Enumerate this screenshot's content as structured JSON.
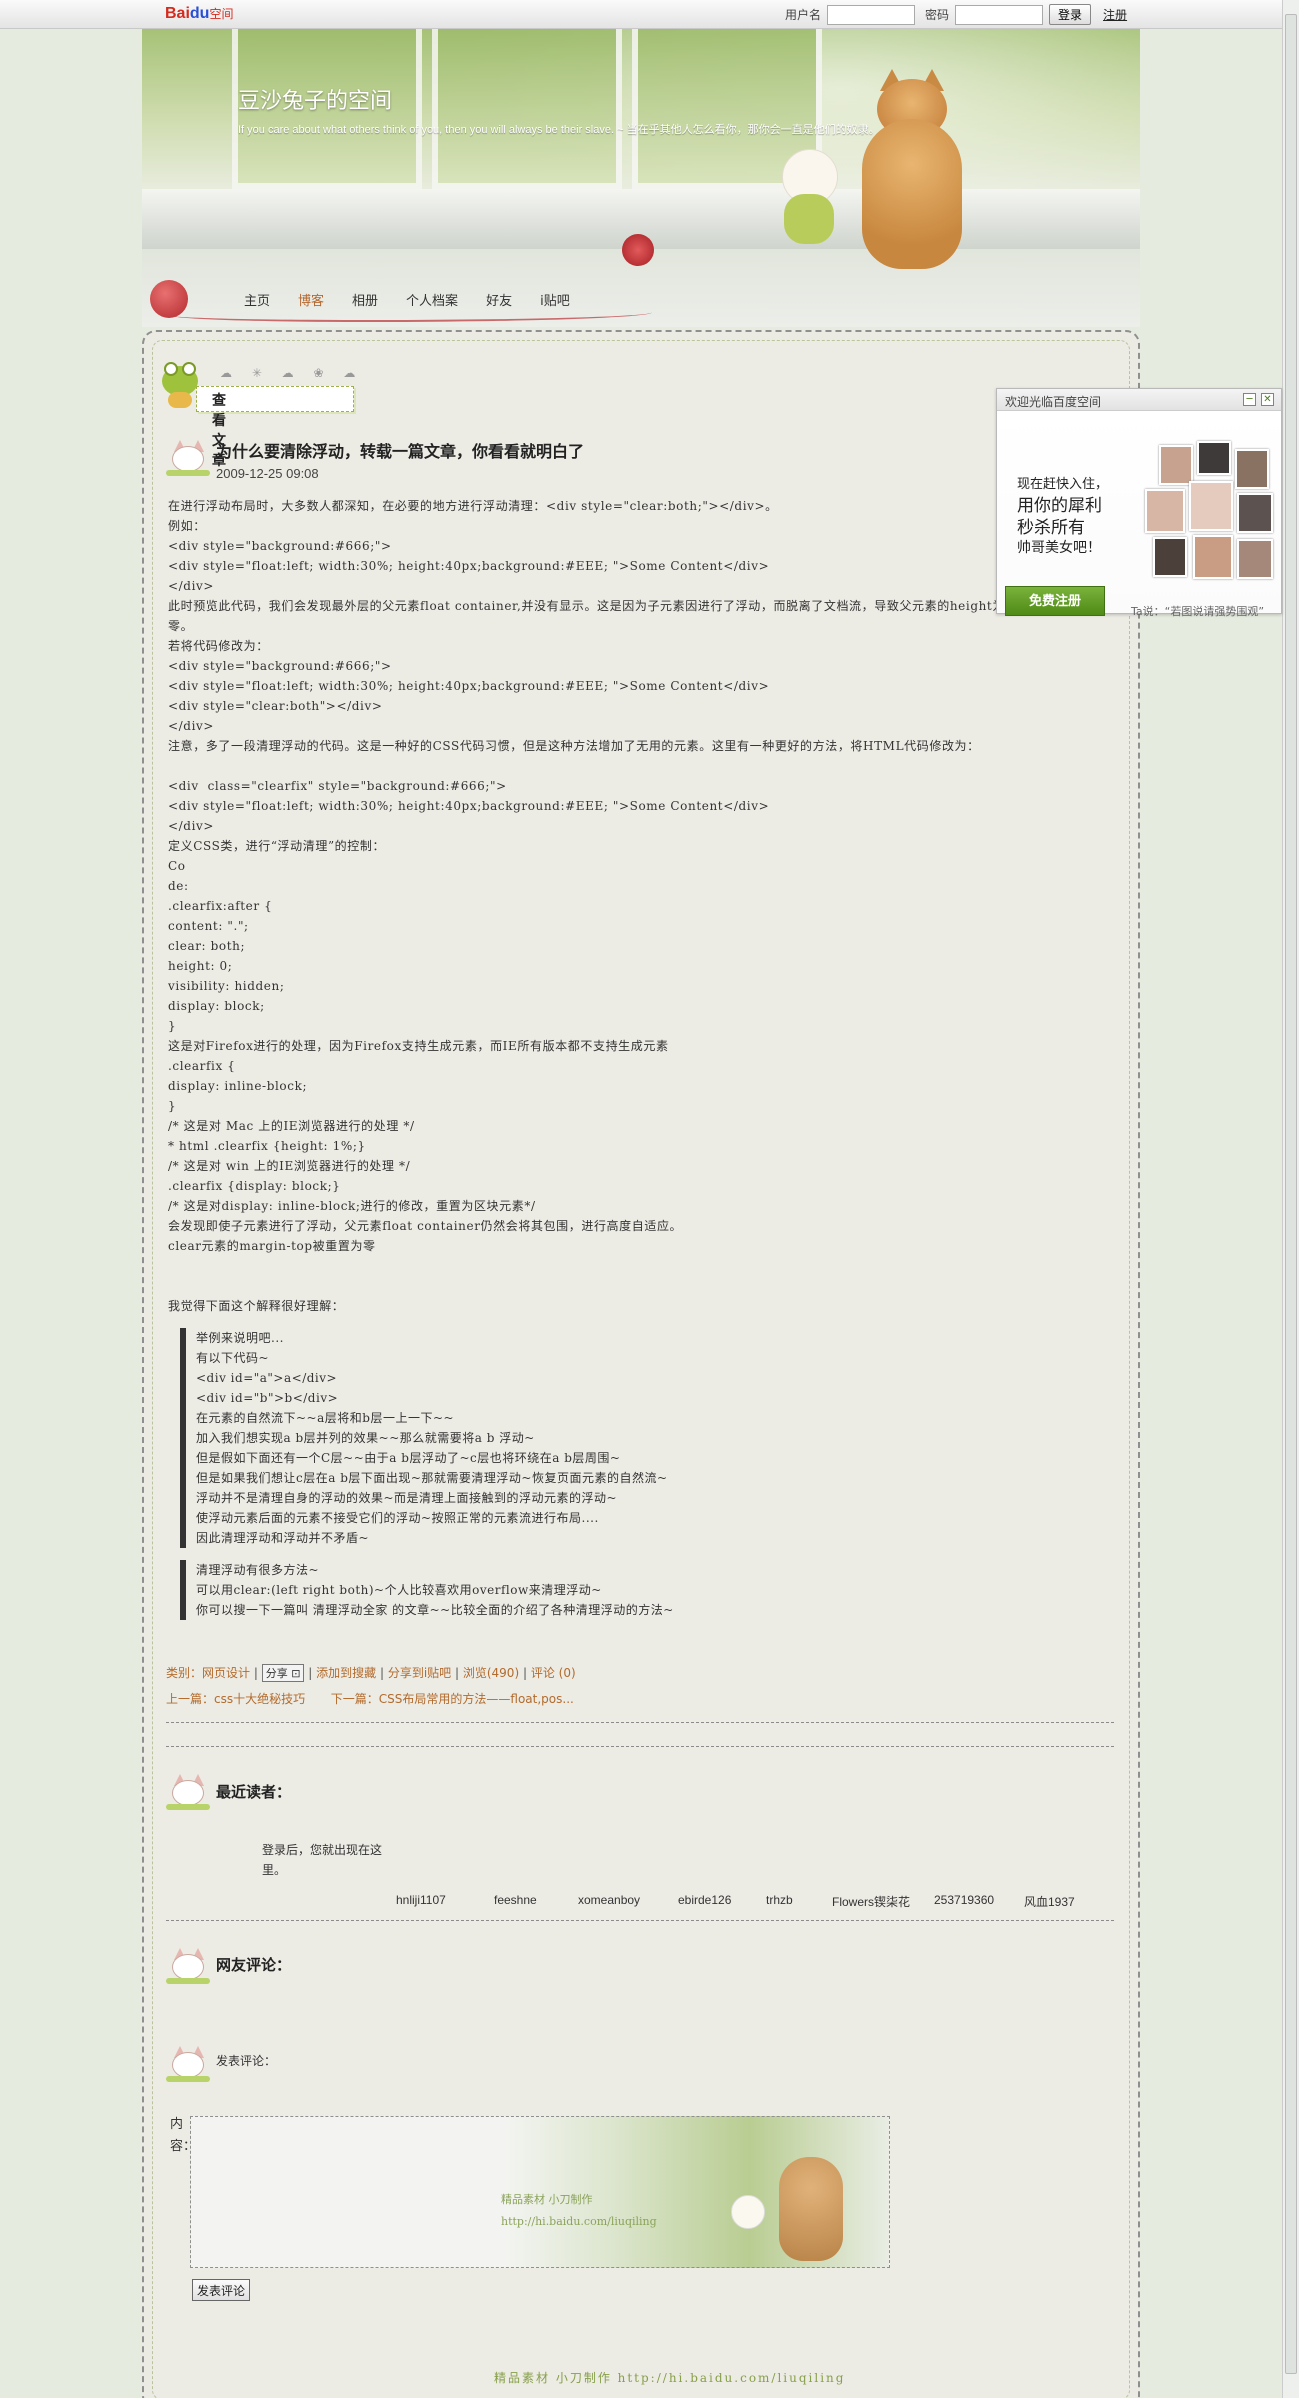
{
  "topbar": {
    "logo_main": "Bai",
    "logo_paw": "du",
    "logo_sub": "空间",
    "username_label": "用户名",
    "password_label": "密码",
    "login_button": "登录",
    "register_link": "注册"
  },
  "blog": {
    "title": "豆沙兔子的空间",
    "subtitle": "If you care about what others think of you, then you will always be their slave. ~ 当在乎其他人怎么看你，那你会一直是他们的奴隶。"
  },
  "nav": {
    "items": [
      "主页",
      "博客",
      "相册",
      "个人档案",
      "好友",
      "i贴吧"
    ],
    "active_index": 1
  },
  "section": {
    "view_article": "查看文章"
  },
  "article": {
    "title": "为什么要清除浮动，转载一篇文章，你看看就明白了",
    "date": "2009-12-25 09:08",
    "lines": [
      "在进行浮动布局时，大多数人都深知，在必要的地方进行浮动清理：<div style=\"clear:both;\"></div>。",
      "例如：",
      "<div style=\"background:#666;\">",
      "<div style=\"float:left; width:30%; height:40px;background:#EEE; \">Some Content</div>",
      "</div>",
      "此时预览此代码，我们会发现最外层的父元素float container,并没有显示。这是因为子元素因进行了浮动，而脱离了文档流，导致父元素的height为",
      "零。",
      "若将代码修改为：",
      "<div style=\"background:#666;\">",
      "<div style=\"float:left; width:30%; height:40px;background:#EEE; \">Some Content</div>",
      "<div style=\"clear:both\"></div>",
      "</div>",
      "注意，多了一段清理浮动的代码。这是一种好的CSS代码习惯，但是这种方法增加了无用的元素。这里有一种更好的方法，将HTML代码修改为：",
      "",
      "<div  class=\"clearfix\" style=\"background:#666;\">",
      "<div style=\"float:left; width:30%; height:40px;background:#EEE; \">Some Content</div>",
      "</div>",
      "定义CSS类，进行“浮动清理”的控制：",
      "Co",
      "de:",
      ".clearfix:after {",
      "content: \".\";",
      "clear: both;",
      "height: 0;",
      "visibility: hidden;",
      "display: block;",
      "}",
      "这是对Firefox进行的处理，因为Firefox支持生成元素，而IE所有版本都不支持生成元素",
      ".clearfix {",
      "display: inline-block;",
      "}",
      "/* 这是对 Mac 上的IE浏览器进行的处理 */",
      "* html .clearfix {height: 1%;}",
      "/* 这是对 win 上的IE浏览器进行的处理 */",
      ".clearfix {display: block;}",
      "/* 这是对display: inline-block;进行的修改，重置为区块元素*/",
      "会发现即使子元素进行了浮动，父元素float container仍然会将其包围，进行高度自适应。",
      "clear元素的margin-top被重置为零",
      "",
      "",
      "我觉得下面这个解释很好理解："
    ],
    "quote1": [
      "举例来说明吧...",
      "有以下代码~",
      "<div id=\"a\">a</div>",
      "<div id=\"b\">b</div>",
      "在元素的自然流下~~a层将和b层一上一下~~",
      "加入我们想实现a b层并列的效果~~那么就需要将a b 浮动~",
      "但是假如下面还有一个C层~~由于a b层浮动了~c层也将环绕在a b层周围~",
      "但是如果我们想让c层在a b层下面出现~那就需要清理浮动~恢复页面元素的自然流~",
      "浮动并不是清理自身的浮动的效果~而是清理上面接触到的浮动元素的浮动~",
      "使浮动元素后面的元素不接受它们的浮动~按照正常的元素流进行布局....",
      "因此清理浮动和浮动并不矛盾~"
    ],
    "quote2": [
      "清理浮动有很多方法~",
      "可以用clear:(left right both)~个人比较喜欢用overflow来清理浮动~",
      "你可以搜一下一篇叫 清理浮动全家 的文章~~比较全面的介绍了各种清理浮动的方法~"
    ]
  },
  "meta": {
    "category_label": "类别：",
    "category": "网页设计",
    "share": "分享",
    "add_search": "添加到搜藏",
    "share_post": "分享到i贴吧",
    "views": "浏览(490)",
    "comments": "评论 (0)",
    "prev_label": "上一篇：",
    "prev": "css十大绝秘技巧",
    "next_label": "下一篇：",
    "next": "CSS布局常用的方法——float,pos..."
  },
  "readers": {
    "heading": "最近读者：",
    "login_tip": "登录后，您就出现在这里。",
    "names": [
      "hnliji1107",
      "feeshne",
      "xomeanboy",
      "ebirde126",
      "trhzb",
      "Flowers锲柒花",
      "253719360",
      "风血1937"
    ]
  },
  "comments": {
    "heading": "网友评论：",
    "post_label": "发表评论：",
    "content_label": "内容：",
    "box_sig_1": "精品素材 小刀制作",
    "box_sig_2": "http://hi.baidu.com/liuqiling",
    "submit": "发表评论"
  },
  "footer": {
    "sig": "精品素材  小刀制作     http://hi.baidu.com/liuqiling"
  },
  "ad": {
    "title": "欢迎光临百度空间",
    "minimize": "─",
    "close": "✕",
    "line1": "现在赶快入住，",
    "line2": "用你的犀利",
    "line3": "秒杀所有",
    "line4": "帅哥美女吧！",
    "register": "免费注册",
    "tag": "Ta说：“若图说请强势围观”"
  }
}
